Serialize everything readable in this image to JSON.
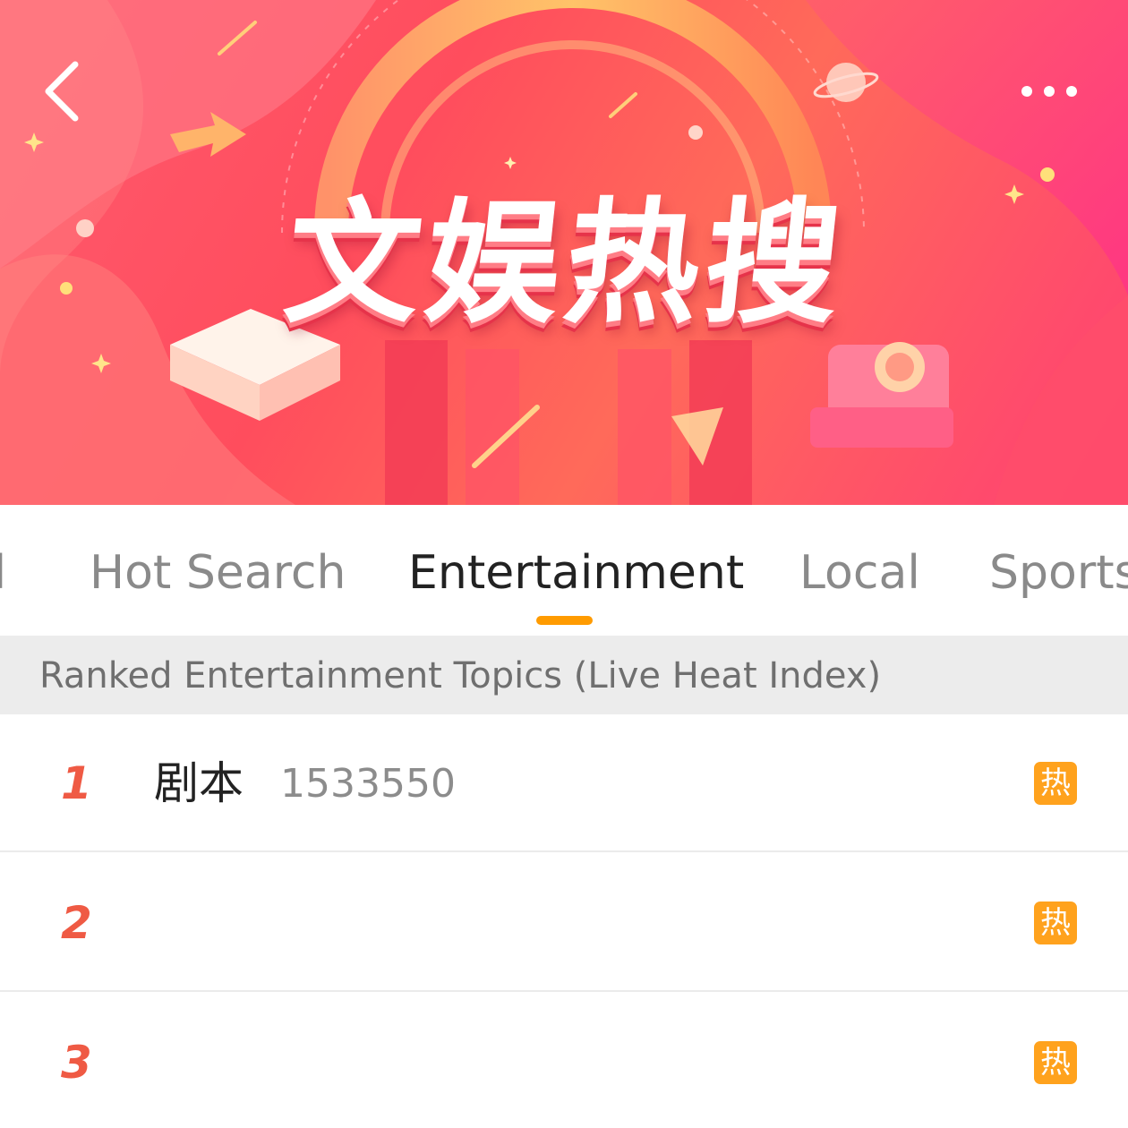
{
  "banner": {
    "title": "文娱热搜",
    "back_icon": "chevron-left-icon",
    "more_icon": "more-dots-icon"
  },
  "tabs": [
    {
      "label": "d"
    },
    {
      "label": "Hot Search"
    },
    {
      "label": "Entertainment",
      "active": true
    },
    {
      "label": "Local"
    },
    {
      "label": "Sports"
    }
  ],
  "section": {
    "header": "Ranked Entertainment Topics (Live Heat Index)"
  },
  "rows": [
    {
      "rank": "1",
      "topic": "剧本",
      "heat": "1533550",
      "badge": "热"
    },
    {
      "rank": "2",
      "topic": "",
      "heat": "",
      "badge": "热"
    },
    {
      "rank": "3",
      "topic": "",
      "heat": "",
      "badge": "热"
    }
  ],
  "colors": {
    "accent": "#ff9b00",
    "rank": "#ef5a44",
    "badge": "#ffa21d",
    "banner": "#ff4d5d"
  }
}
